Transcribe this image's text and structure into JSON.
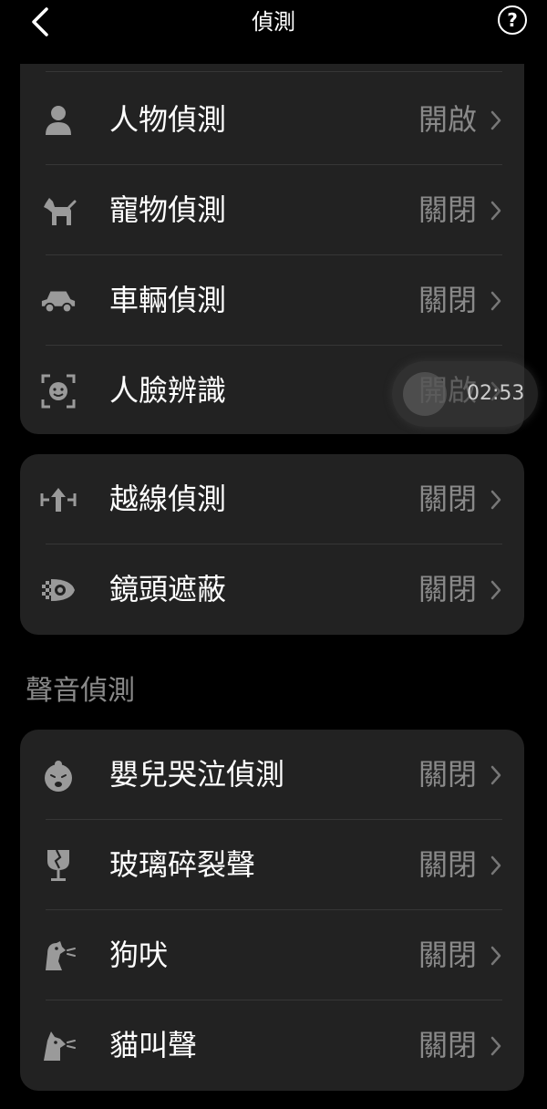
{
  "header": {
    "title": "偵測",
    "back_icon": "chevron-left-icon",
    "help_label": "?"
  },
  "card1": {
    "rows": [
      {
        "label": "人物偵測",
        "status": "開啟",
        "icon": "person-icon"
      },
      {
        "label": "寵物偵測",
        "status": "關閉",
        "icon": "pet-icon"
      },
      {
        "label": "車輛偵測",
        "status": "關閉",
        "icon": "car-icon"
      },
      {
        "label": "人臉辨識",
        "status": "開啟",
        "icon": "face-icon"
      }
    ]
  },
  "card2": {
    "rows": [
      {
        "label": "越線偵測",
        "status": "關閉",
        "icon": "line-crossing-icon"
      },
      {
        "label": "鏡頭遮蔽",
        "status": "關閉",
        "icon": "lens-block-icon"
      }
    ]
  },
  "sound_section": {
    "title": "聲音偵測",
    "rows": [
      {
        "label": "嬰兒哭泣偵測",
        "status": "關閉",
        "icon": "baby-cry-icon"
      },
      {
        "label": "玻璃碎裂聲",
        "status": "關閉",
        "icon": "glass-break-icon"
      },
      {
        "label": "狗吠",
        "status": "關閉",
        "icon": "dog-bark-icon"
      },
      {
        "label": "貓叫聲",
        "status": "關閉",
        "icon": "cat-meow-icon"
      }
    ]
  },
  "timer": {
    "text": "02:53"
  }
}
